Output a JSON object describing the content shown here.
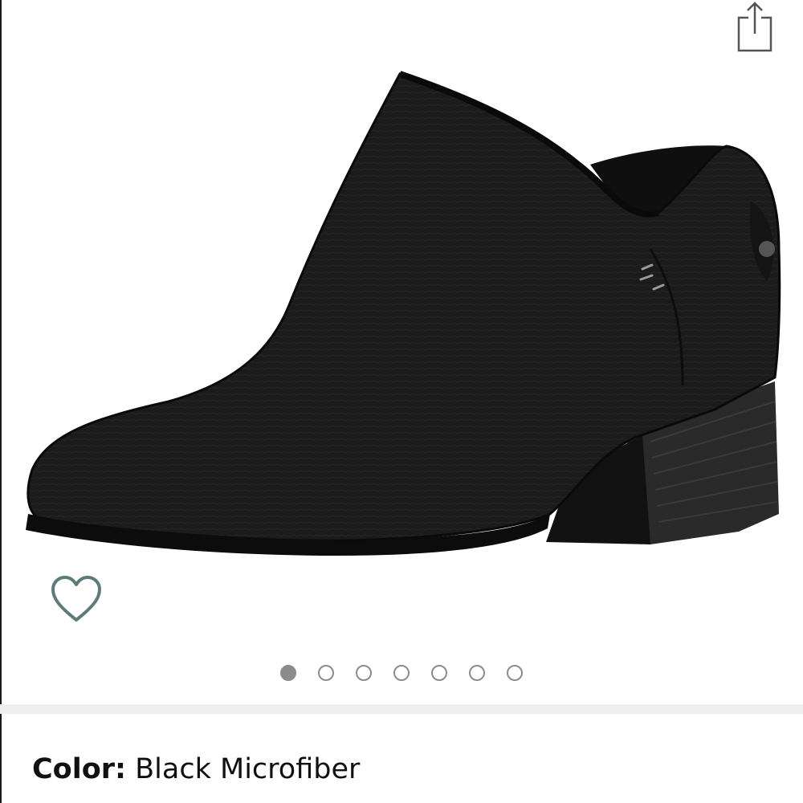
{
  "product": {
    "color_label": "Color:",
    "color_value": "Black Microfiber"
  },
  "gallery": {
    "image_count": 7,
    "active_index": 0
  },
  "icons": {
    "share": "share-icon",
    "wishlist": "heart-icon"
  },
  "colors": {
    "dot_gray": "#8c8c8c",
    "heart_teal": "#5f7a7a",
    "divider": "#eeeeee"
  }
}
